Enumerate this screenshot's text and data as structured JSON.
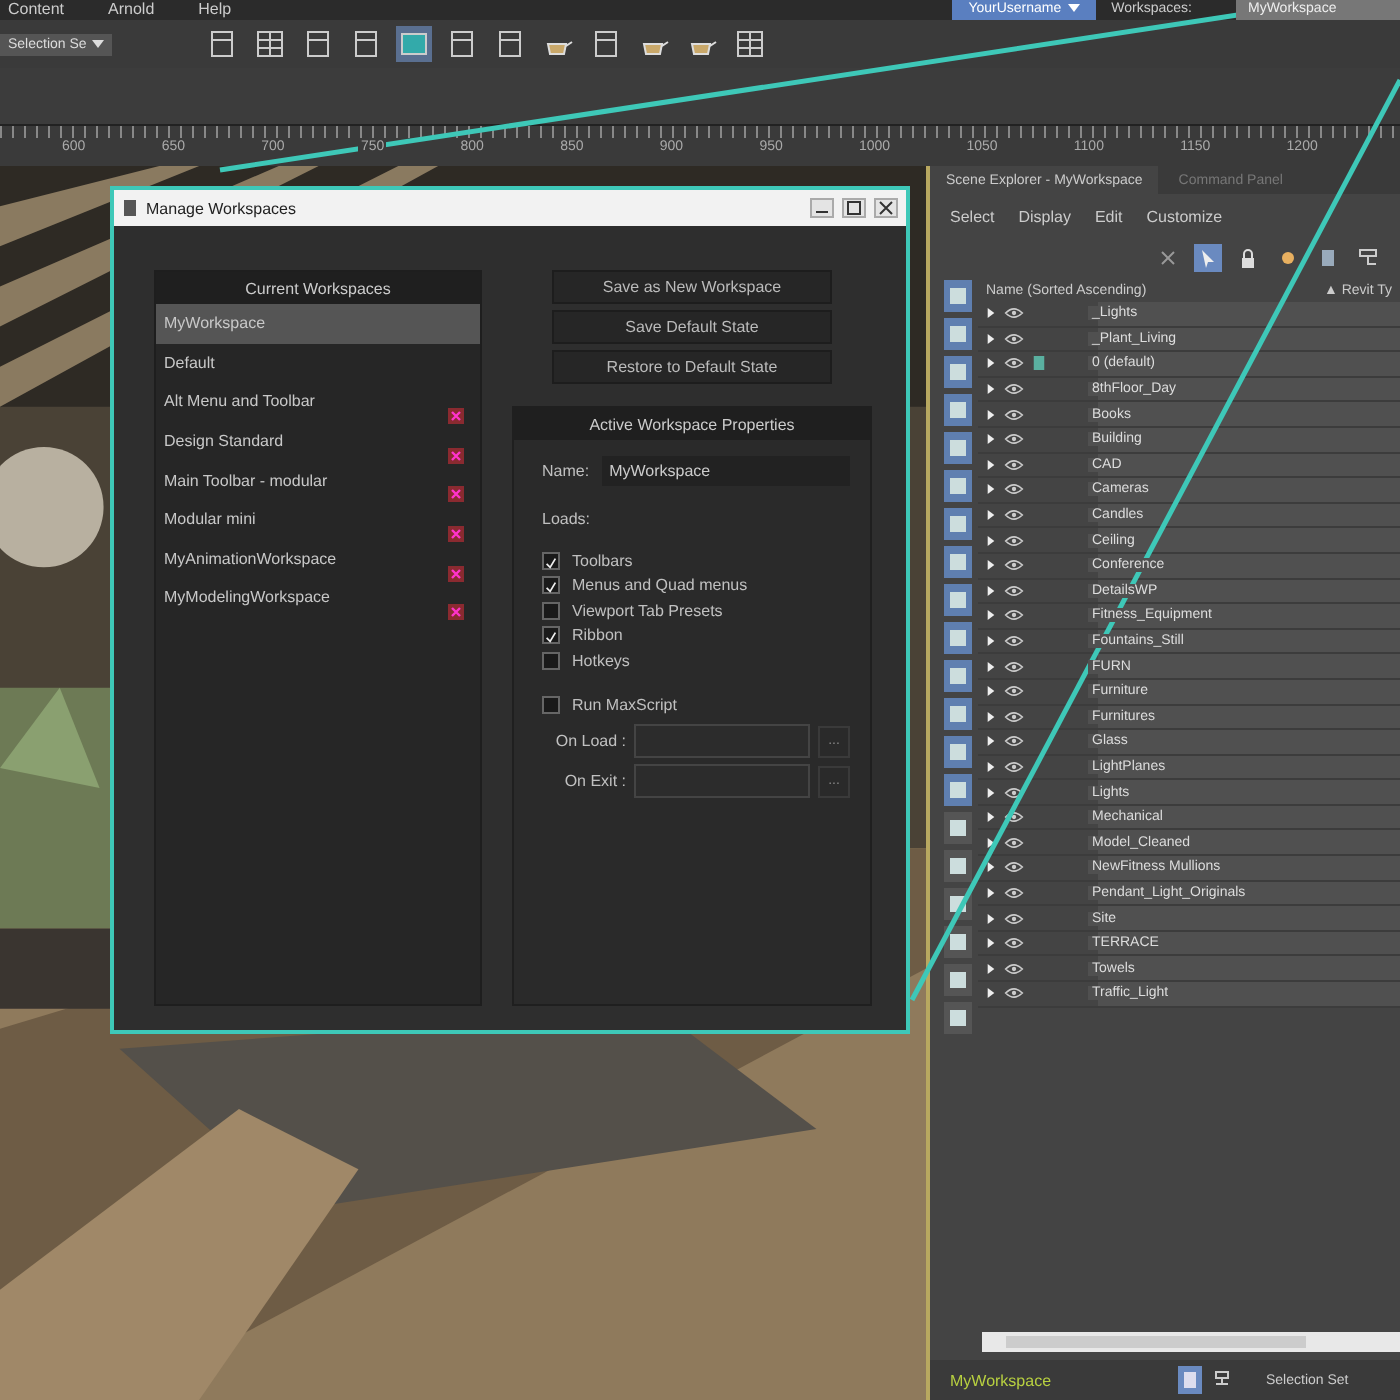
{
  "menu_bar": {
    "items": [
      "Content",
      "Arnold",
      "Help"
    ]
  },
  "toolbar": {
    "selection_set": "Selection Se",
    "user": "YourUsername",
    "workspaces_label": "Workspaces:",
    "workspace": "MyWorkspace"
  },
  "ruler": {
    "ticks": [
      "600",
      "650",
      "700",
      "750",
      "800",
      "850",
      "900",
      "950",
      "1000",
      "1050",
      "1100",
      "1150",
      "1200"
    ]
  },
  "dialog": {
    "title": "Manage Workspaces",
    "list_title": "Current Workspaces",
    "workspaces": [
      {
        "name": "MyWorkspace",
        "selected": true,
        "removable": false
      },
      {
        "name": "Default",
        "selected": false,
        "removable": false
      },
      {
        "name": "Alt Menu and Toolbar",
        "selected": false,
        "removable": true
      },
      {
        "name": "Design Standard",
        "selected": false,
        "removable": true
      },
      {
        "name": "Main Toolbar - modular",
        "selected": false,
        "removable": true
      },
      {
        "name": "Modular mini",
        "selected": false,
        "removable": true
      },
      {
        "name": "MyAnimationWorkspace",
        "selected": false,
        "removable": true
      },
      {
        "name": "MyModelingWorkspace",
        "selected": false,
        "removable": true
      }
    ],
    "buttons": [
      "Save as New Workspace",
      "Save Default State",
      "Restore to Default State"
    ],
    "properties_title": "Active Workspace Properties",
    "name_label": "Name:",
    "name_value": "MyWorkspace",
    "loads_label": "Loads:",
    "loads": [
      {
        "label": "Toolbars",
        "checked": true
      },
      {
        "label": "Menus and Quad menus",
        "checked": true
      },
      {
        "label": "Viewport Tab Presets",
        "checked": false
      },
      {
        "label": "Ribbon",
        "checked": true
      },
      {
        "label": "Hotkeys",
        "checked": false
      }
    ],
    "run_maxscript": {
      "label": "Run MaxScript",
      "checked": false
    },
    "on_load_label": "On Load :",
    "on_exit_label": "On Exit :",
    "browse": "..."
  },
  "scene_explorer": {
    "tabs": [
      {
        "label": "Scene Explorer - MyWorkspace",
        "selected": true
      },
      {
        "label": "Command Panel",
        "selected": false
      }
    ],
    "menu": [
      "Select",
      "Display",
      "Edit",
      "Customize"
    ],
    "column_header": "Name (Sorted Ascending)",
    "column_2": "▲ Revit Ty",
    "layers": [
      {
        "name": "_Lights",
        "active": false
      },
      {
        "name": "_Plant_Living",
        "active": false
      },
      {
        "name": "0 (default)",
        "active": true
      },
      {
        "name": "8thFloor_Day",
        "active": false
      },
      {
        "name": "Books",
        "active": false
      },
      {
        "name": "Building",
        "active": false
      },
      {
        "name": "CAD",
        "active": false
      },
      {
        "name": "Cameras",
        "active": false
      },
      {
        "name": "Candles",
        "active": false
      },
      {
        "name": "Ceiling",
        "active": false
      },
      {
        "name": "Conference",
        "active": false
      },
      {
        "name": "DetailsWP",
        "active": false
      },
      {
        "name": "Fitness_Equipment",
        "active": false
      },
      {
        "name": "Fountains_Still",
        "active": false
      },
      {
        "name": "FURN",
        "active": false
      },
      {
        "name": "Furniture",
        "active": false
      },
      {
        "name": "Furnitures",
        "active": false
      },
      {
        "name": "Glass",
        "active": false
      },
      {
        "name": "LightPlanes",
        "active": false
      },
      {
        "name": "Lights",
        "active": false
      },
      {
        "name": "Mechanical",
        "active": false
      },
      {
        "name": "Model_Cleaned",
        "active": false
      },
      {
        "name": "NewFitness Mullions",
        "active": false
      },
      {
        "name": "Pendant_Light_Originals",
        "active": false
      },
      {
        "name": "Site",
        "active": false
      },
      {
        "name": "TERRACE",
        "active": false
      },
      {
        "name": "Towels",
        "active": false
      },
      {
        "name": "Traffic_Light",
        "active": false
      }
    ],
    "workspace_dropdown": "MyWorkspace",
    "selection_set_label": "Selection Set"
  }
}
